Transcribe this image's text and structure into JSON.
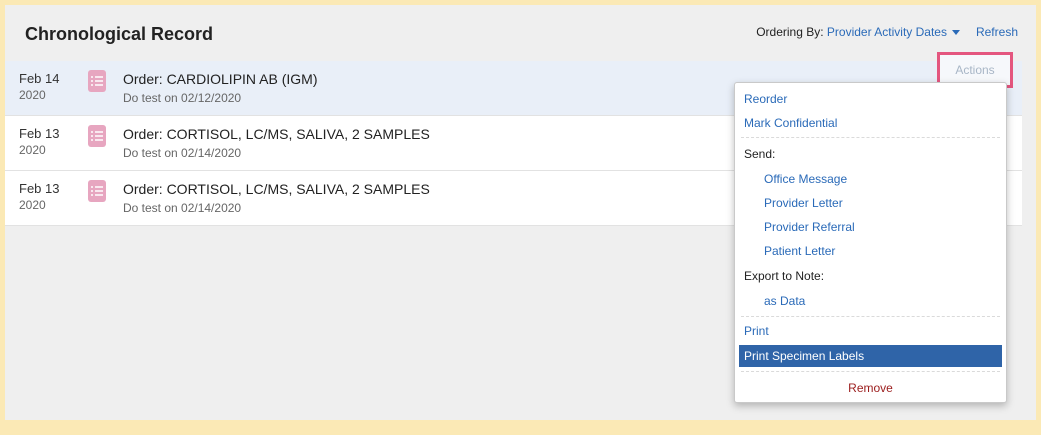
{
  "header": {
    "title": "Chronological Record",
    "ordering_label": "Ordering By:",
    "ordering_value": "Provider Activity Dates",
    "refresh": "Refresh"
  },
  "records": [
    {
      "month_day": "Feb 14",
      "year": "2020",
      "title": "Order: CARDIOLIPIN AB (IGM)",
      "sub": "Do test on 02/12/2020"
    },
    {
      "month_day": "Feb 13",
      "year": "2020",
      "title": "Order: CORTISOL, LC/MS, SALIVA, 2 SAMPLES",
      "sub": "Do test on 02/14/2020"
    },
    {
      "month_day": "Feb 13",
      "year": "2020",
      "title": "Order: CORTISOL, LC/MS, SALIVA, 2 SAMPLES",
      "sub": "Do test on 02/14/2020"
    }
  ],
  "actions_button": "Actions",
  "menu": {
    "reorder": "Reorder",
    "mark_confidential": "Mark Confidential",
    "send_header": "Send:",
    "office_message": "Office Message",
    "provider_letter": "Provider Letter",
    "provider_referral": "Provider Referral",
    "patient_letter": "Patient Letter",
    "export_header": "Export to Note:",
    "as_data": "as Data",
    "print": "Print",
    "print_specimen_labels": "Print Specimen Labels",
    "remove": "Remove"
  },
  "colors": {
    "link": "#2a6ab8",
    "highlight": "#2f64a8",
    "remove": "#9b1c1c",
    "callout": "#e4567f",
    "doc_icon": "#e7a6c0",
    "frame": "#fbe9b5"
  }
}
